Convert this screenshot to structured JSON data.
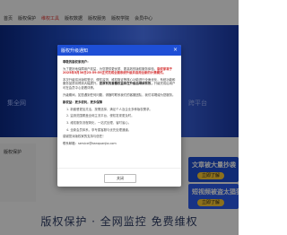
{
  "nav": {
    "items": [
      "首页",
      "版权保护",
      "维权工具",
      "版权数据",
      "版权服务",
      "版权学院",
      "会员中心"
    ]
  },
  "banner": {
    "left_text": "集全网",
    "right_text": "跨平台"
  },
  "left_strip": {
    "text": "版权保护"
  },
  "promos": [
    {
      "title": "文章被大量抄袭",
      "button": "立即了解"
    },
    {
      "title": "短视频被盗太猖狂",
      "button": "立即了解"
    }
  ],
  "slogan": "版权保护 · 全网监控 免费维权",
  "modal": {
    "title": "版权升级通知",
    "close": "×",
    "greeting": "尊敬的版权家用户：",
    "p1": "为了更好地保障用户权益，为您提供更优质、更高效的版权服务体验，",
    "p1_red": "版权家将于2025年5月30日23:59:59正式完成全面系统升级并启用全新的计费模式。",
    "p2": "本次升级将对版权登记、侵权监测、维权取证等核心功能进行全面优化，系统功能和服务品质将得到大幅提升。",
    "p2_bold": "您原有的套餐权益将在升级后继续有效，",
    "p2_tail": "升级完成后用户可在会员中心查看详情。",
    "p3": "升级期间，如您遇到任何问题，请随时联系我们的客服团队，我们将竭诚为您服务。",
    "section": "新权益：更多权利，更多保障",
    "items": [
      "1. 新套餐更加灵活，按需选择，满足个人及企业多种版权需求。",
      "2. 监测范围覆盖全网主流平台，侵权发现更及时。",
      "3. 维权服务流程简化，一站式处理，省时省心。",
      "4. 全新会员体系，享专属客服与优先处理通道。"
    ],
    "thanks": "感谢您对版权家的支持与信任！",
    "contact": "联系邮箱：service@banquanjia.com",
    "button": "关闭"
  },
  "colors": {
    "modal_header": "#1e4fd6",
    "overlay": "rgba(0,0,0,0.45)",
    "highlight": "#d32f2f"
  }
}
